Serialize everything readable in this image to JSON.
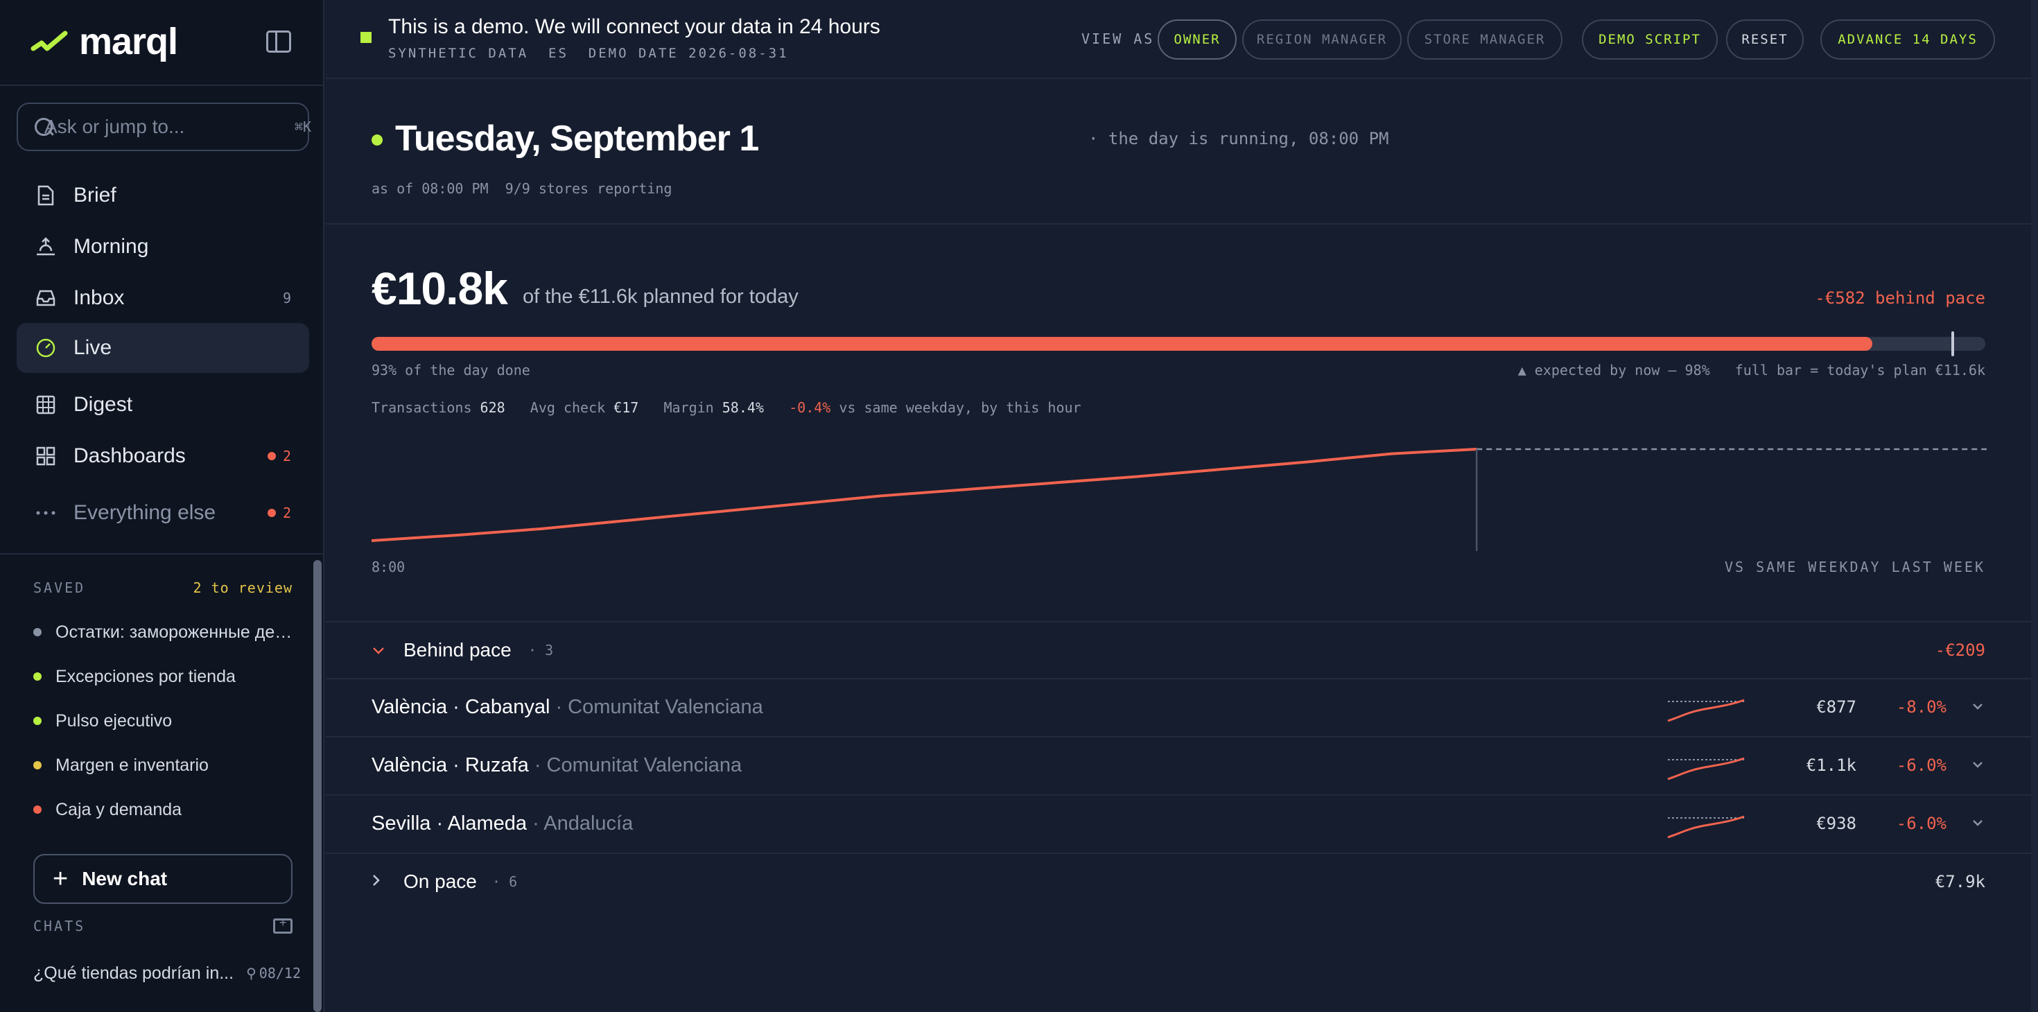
{
  "app": {
    "name": "marql"
  },
  "search": {
    "placeholder": "Ask or jump to...",
    "shortcut": "⌘K"
  },
  "nav": [
    {
      "label": "Brief",
      "icon": "document-icon"
    },
    {
      "label": "Morning",
      "icon": "sunrise-icon"
    },
    {
      "label": "Inbox",
      "icon": "inbox-icon",
      "count": "9"
    },
    {
      "label": "Live",
      "icon": "gauge-icon",
      "active": true
    },
    {
      "label": "Digest",
      "icon": "grid-table-icon"
    },
    {
      "label": "Dashboards",
      "icon": "dashboard-icon",
      "badge": "2"
    },
    {
      "label": "Everything else",
      "icon": "more-dots-icon",
      "badge": "2"
    }
  ],
  "saved": {
    "title": "SAVED",
    "review": "2 to review",
    "items": [
      {
        "label": "Остатки: замороженные ден...",
        "color": "#8b94a7"
      },
      {
        "label": "Excepciones por tienda",
        "color": "#b8f042"
      },
      {
        "label": "Pulso ejecutivo",
        "color": "#b8f042"
      },
      {
        "label": "Margen e inventario",
        "color": "#e5c54a"
      },
      {
        "label": "Caja y demanda",
        "color": "#f2634f"
      }
    ]
  },
  "new_chat": {
    "label": "New chat"
  },
  "chats": {
    "title": "CHATS",
    "items": [
      {
        "label": "¿Qué tiendas podrían in...",
        "date": "08/12"
      }
    ]
  },
  "banner": {
    "title": "This is a demo. We will connect your data in 24 hours",
    "subtitle": "SYNTHETIC DATA  ES  DEMO DATE 2026-08-31",
    "view_as": "VIEW AS",
    "buttons": {
      "owner": "OWNER",
      "region_manager": "REGION MANAGER",
      "store_manager": "STORE MANAGER",
      "demo_script": "DEMO SCRIPT",
      "reset": "RESET",
      "advance": "ADVANCE 14 DAYS"
    }
  },
  "day": {
    "title": "Tuesday, September 1",
    "status": "· the day is running, 08:00 PM",
    "as_of": "as of 08:00 PM  9/9 stores reporting"
  },
  "revenue": {
    "amount": "€10.8k",
    "plan_text": "of the €11.6k planned for today",
    "pace_gap": "-€582 behind pace",
    "progress_fraction": 0.93,
    "expected_fraction": 0.98,
    "done_label": "93% of the day done",
    "expected_label": "▲ expected by now — 98%   full bar = today's plan €11.6k"
  },
  "metrics": {
    "transactions_label": "Transactions",
    "transactions_value": "628",
    "avg_check_label": "Avg check",
    "avg_check_value": "€17",
    "margin_label": "Margin",
    "margin_value": "58.4%",
    "delta_value": "-0.4%",
    "delta_label": "vs same weekday, by this hour"
  },
  "chart_data": {
    "type": "line",
    "x_start_label": "8:00",
    "compare_label": "VS SAME WEEKDAY LAST WEEK",
    "series": [
      {
        "values": [
          0,
          0.06,
          0.13,
          0.22,
          0.31,
          0.4,
          0.49,
          0.56,
          0.63,
          0.7,
          0.78,
          0.86,
          0.95,
          1.0
        ],
        "color": "#f2634f"
      }
    ],
    "now_index": 13,
    "total_points": 20
  },
  "behind": {
    "title": "Behind pace",
    "count": "· 3",
    "total": "-€209",
    "stores": [
      {
        "name": "València · Cabanyal",
        "region": "· Comunitat Valenciana",
        "value": "€877",
        "delta": "-8.0%"
      },
      {
        "name": "València · Ruzafa",
        "region": "· Comunitat Valenciana",
        "value": "€1.1k",
        "delta": "-6.0%"
      },
      {
        "name": "Sevilla · Alameda",
        "region": "· Andalucía",
        "value": "€938",
        "delta": "-6.0%"
      }
    ]
  },
  "onpace": {
    "title": "On pace",
    "count": "· 6",
    "total": "€7.9k"
  },
  "colors": {
    "accent": "#b8f042",
    "negative": "#f2634f",
    "warning": "#e5c54a"
  }
}
